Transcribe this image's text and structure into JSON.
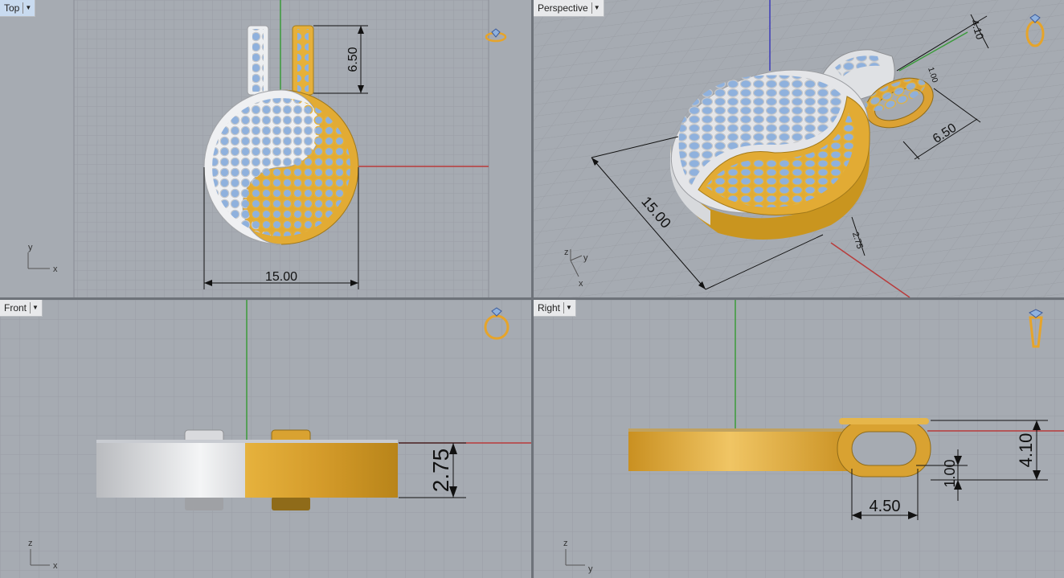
{
  "viewports": {
    "top": {
      "label": "Top",
      "dim_width": "15.00",
      "dim_bail": "6.50",
      "axis_v": "y",
      "axis_h": "x"
    },
    "perspective": {
      "label": "Perspective",
      "dim_width": "15.00",
      "dim_bail": "6.50",
      "dim_bail_top": "4.10",
      "dim_small": "2.75",
      "dim_small2": "1.00",
      "axis_a": "z",
      "axis_b": "y",
      "axis_c": "x"
    },
    "front": {
      "label": "Front",
      "dim_thickness": "2.75",
      "axis_v": "z",
      "axis_h": "x"
    },
    "right": {
      "label": "Right",
      "dim_height": "4.10",
      "dim_inner": "1.00",
      "dim_width": "4.50",
      "axis_v": "z",
      "axis_h": "y"
    }
  },
  "icons": {
    "dropdown": "chevron-down-icon",
    "ring_flat": "ring-gem-icon",
    "ring_persp": "ring-perspective-icon",
    "ring_front": "ring-front-icon",
    "ring_side": "ring-side-icon"
  },
  "colors": {
    "viewport_bg": "#a6abb2",
    "grid_line": "#999da4",
    "grid_major": "#8a8e95",
    "gold": "#e0ad36",
    "silver": "#e4e5e8",
    "gem": "#8fb1dd",
    "x_axis": "#b83b3b",
    "y_axis": "#3b9b3b",
    "z_axis": "#3b3bb8",
    "active_label": "#c9dbf0"
  }
}
